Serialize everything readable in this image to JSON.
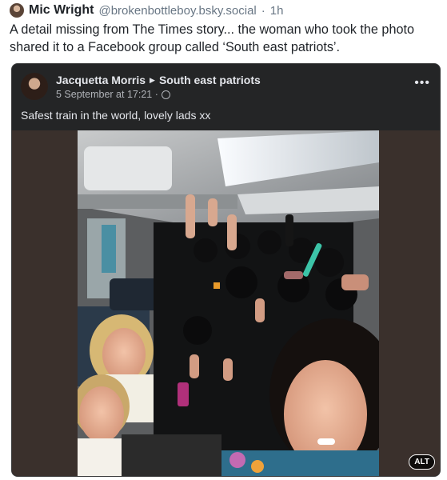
{
  "post": {
    "author_name": "Mic Wright",
    "handle": "@brokenbottleboy.bsky.social",
    "separator": "·",
    "age": "1h",
    "text": "A detail missing from The Times story... the woman who took the photo shared it to a Facebook group called ‘South east patriots’."
  },
  "embed": {
    "poster_name": "Jacquetta Morris",
    "group_name": "South east patriots",
    "date": "5 September at 17:21 ·",
    "caption": "Safest train in the world, lovely lads xx",
    "more_icon": "more-horizontal-icon",
    "alt_label": "ALT"
  },
  "colors": {
    "embed_bg": "#242526",
    "text_primary": "#e4e6eb",
    "text_secondary": "#b0b3b8"
  }
}
